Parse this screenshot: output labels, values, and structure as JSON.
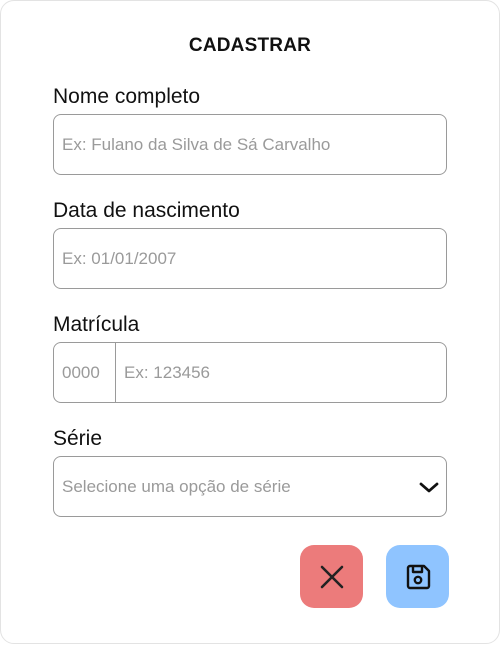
{
  "form": {
    "title": "CADASTRAR",
    "fields": {
      "nome": {
        "label": "Nome completo",
        "placeholder": "Ex: Fulano da Silva de Sá Carvalho",
        "value": ""
      },
      "nascimento": {
        "label": "Data de nascimento",
        "placeholder": "Ex: 01/01/2007",
        "value": ""
      },
      "matricula": {
        "label": "Matrícula",
        "prefix": "0000",
        "placeholder": "Ex: 123456",
        "value": ""
      },
      "serie": {
        "label": "Série",
        "placeholder": "Selecione uma opção de série",
        "icon": "chevron-down-icon"
      }
    },
    "actions": {
      "cancel": {
        "icon": "close-icon",
        "color": "#ec7b7b"
      },
      "save": {
        "icon": "save-icon",
        "color": "#8fc4ff"
      }
    }
  }
}
